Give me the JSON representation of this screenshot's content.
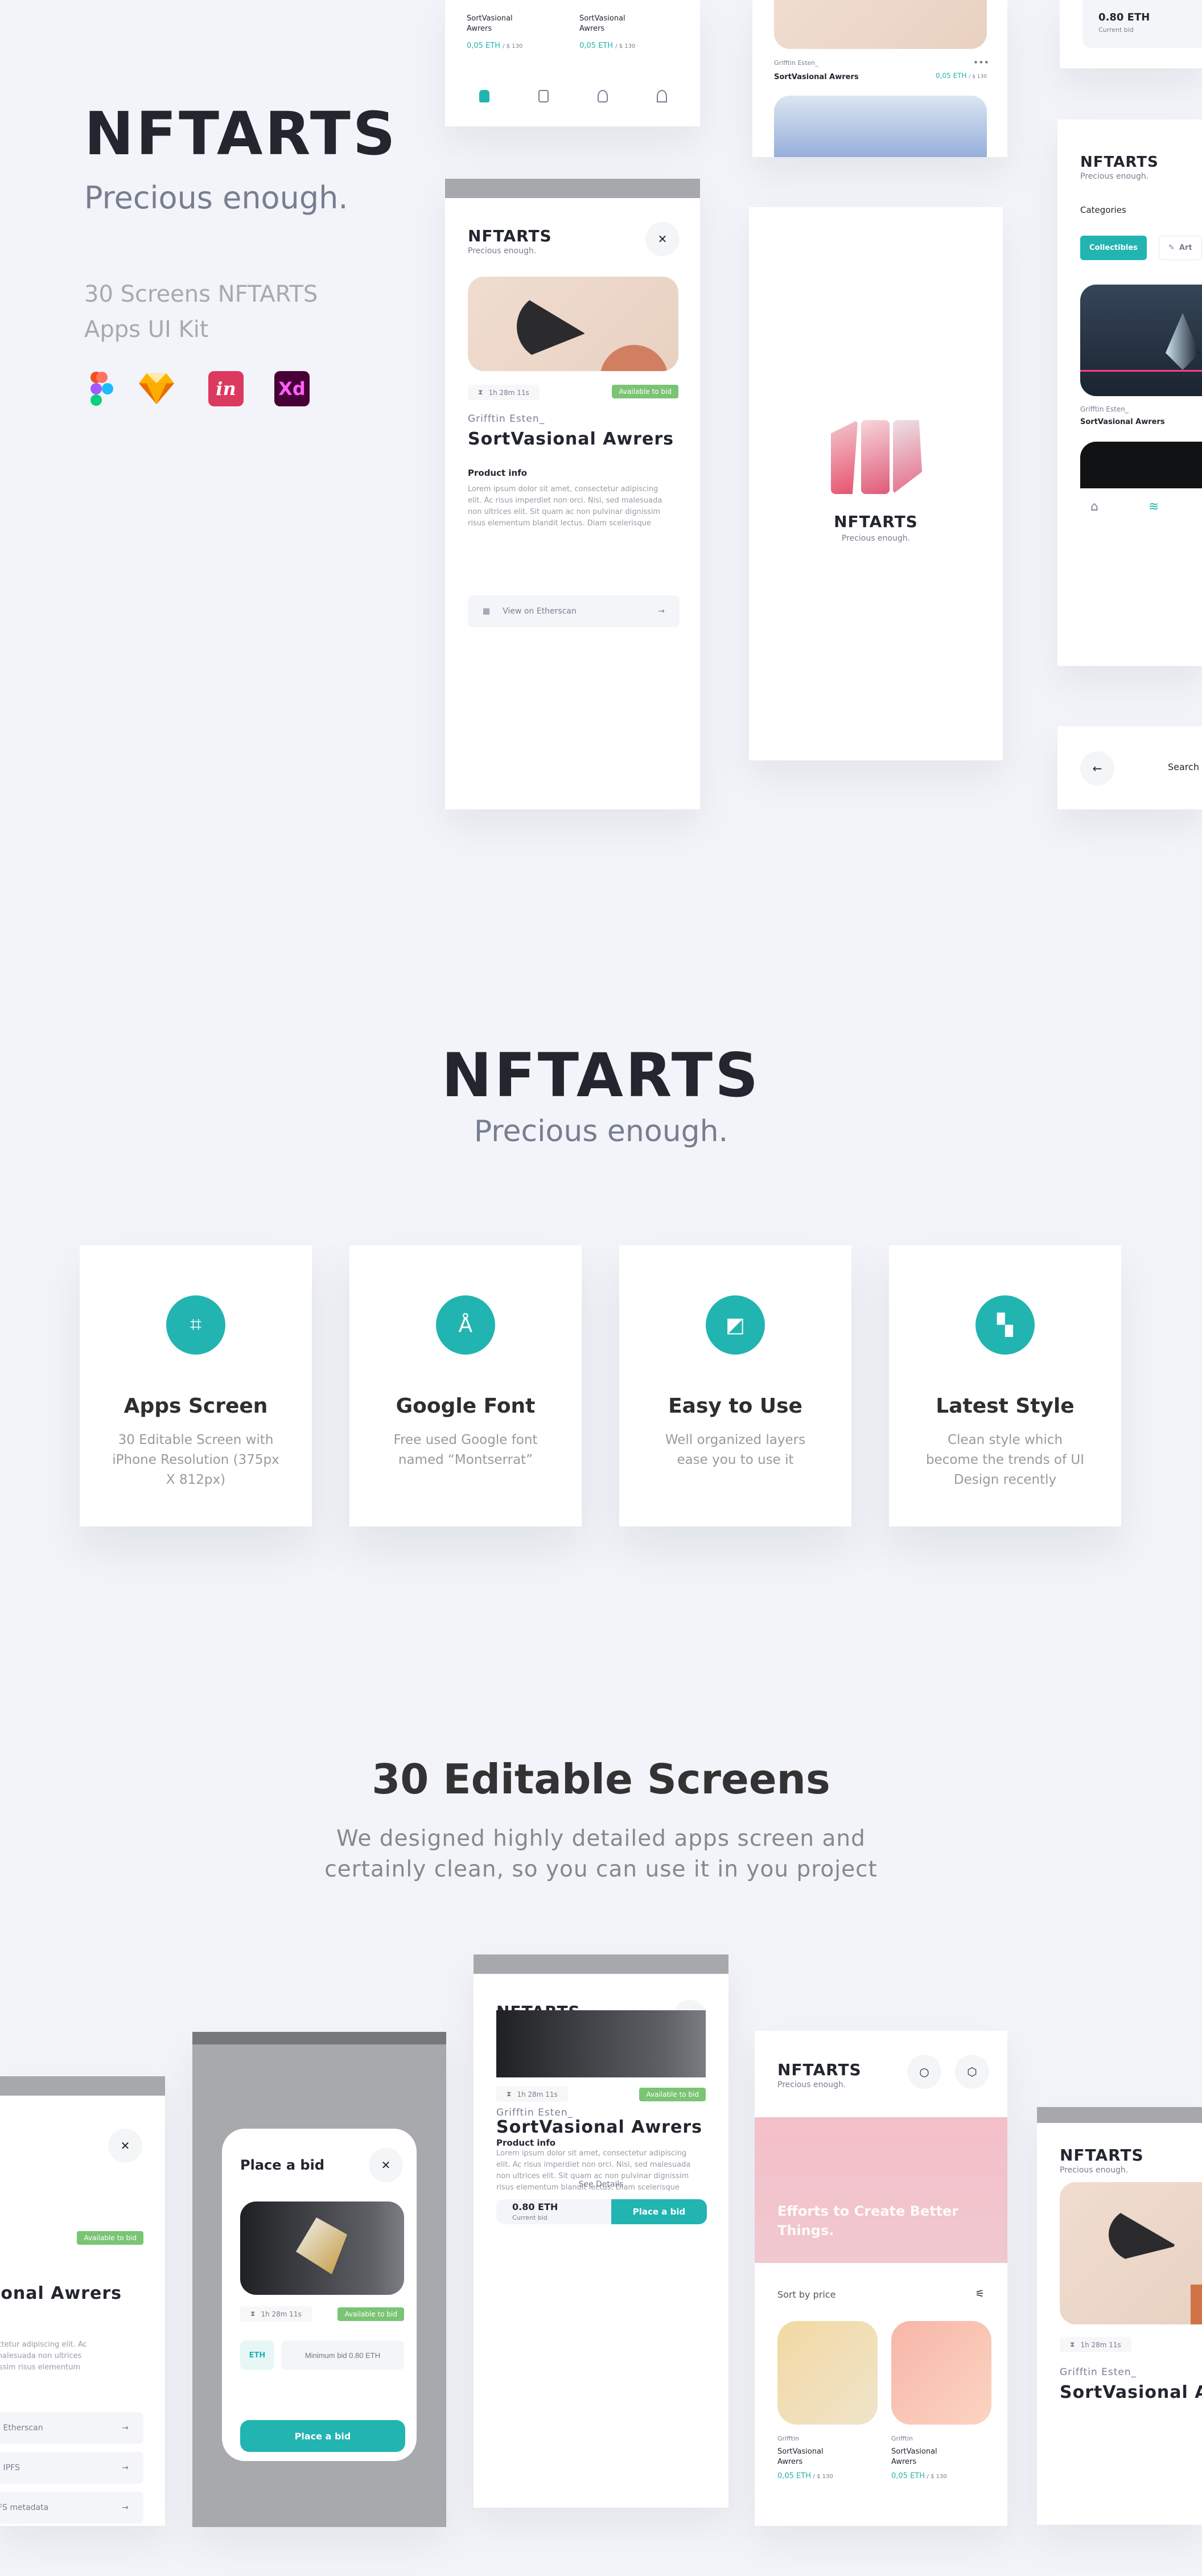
{
  "brand": {
    "name": "NFTARTS",
    "tagline": "Precious enough.",
    "kit_line1": "30 Screens NFTARTS",
    "kit_line2": "Apps UI Kit",
    "accent_color": "#22b4b1",
    "available_color": "#7ac474"
  },
  "tools": [
    {
      "icon": "figma-icon",
      "label": ""
    },
    {
      "icon": "sketch-icon",
      "label": ""
    },
    {
      "icon": "invision-icon",
      "label": "in"
    },
    {
      "icon": "xd-icon",
      "label": "Xd"
    }
  ],
  "product": {
    "creator": "Grifftin Esten_",
    "creator_short": "Grifftin",
    "title": "SortVasional Awrers",
    "title_line1": "SortVasional",
    "title_line2": "Awrers",
    "price_eth": "0,05 ETH",
    "price_usd": "/ $ 130",
    "timer": "1h 28m 11s",
    "status": "Available to bid",
    "info_heading": "Product info",
    "description": "Lorem ipsum dolor sit amet, consectetur adipiscing elit. Ac risus imperdiet non orci. Nisi, sed malesuada non ultrices elit. Sit quam ac non pulvinar dignissim risus elementum blandit lectus. Diam scelerisque",
    "links": [
      "View on Etherscan",
      "View on IPFS",
      "View IPFS metadata"
    ],
    "see_details": "See Details",
    "current_bid": "0.80 ETH",
    "current_bid_label": "Current bid",
    "place_bid": "Place a bid"
  },
  "bid_modal": {
    "title": "Place a bid",
    "currency": "ETH",
    "input_placeholder": "Minimum bid 0.80 ETH",
    "button": "Place a bid"
  },
  "categories": {
    "heading": "Categories",
    "items": [
      "Collectibles",
      "Art"
    ]
  },
  "search_screen": {
    "title": "Search"
  },
  "home_screen": {
    "banner_text": "Efforts to Create Better Things.",
    "sort_label": "Sort by price"
  },
  "second_header": {
    "logo": "NFTARTS",
    "tagline": "Precious enough."
  },
  "features": [
    {
      "icon": "crop-icon",
      "title": "Apps Screen",
      "description": "30 Editable Screen with iPhone Resolution (375px X 812px)"
    },
    {
      "icon": "compass-icon",
      "title": "Google Font",
      "description": "Free used Google font named “Montserrat”"
    },
    {
      "icon": "swatch-icon",
      "title": "Easy to Use",
      "description": "Well organized layers ease you to use it"
    },
    {
      "icon": "layout-icon",
      "title": "Latest Style",
      "description": "Clean style which become the trends of UI Design recently"
    }
  ],
  "screens_section": {
    "title": "30 Editable Screens",
    "subtitle_line1": "We designed highly detailed apps screen and",
    "subtitle_line2": "certainly clean, so you can use it in you project"
  }
}
